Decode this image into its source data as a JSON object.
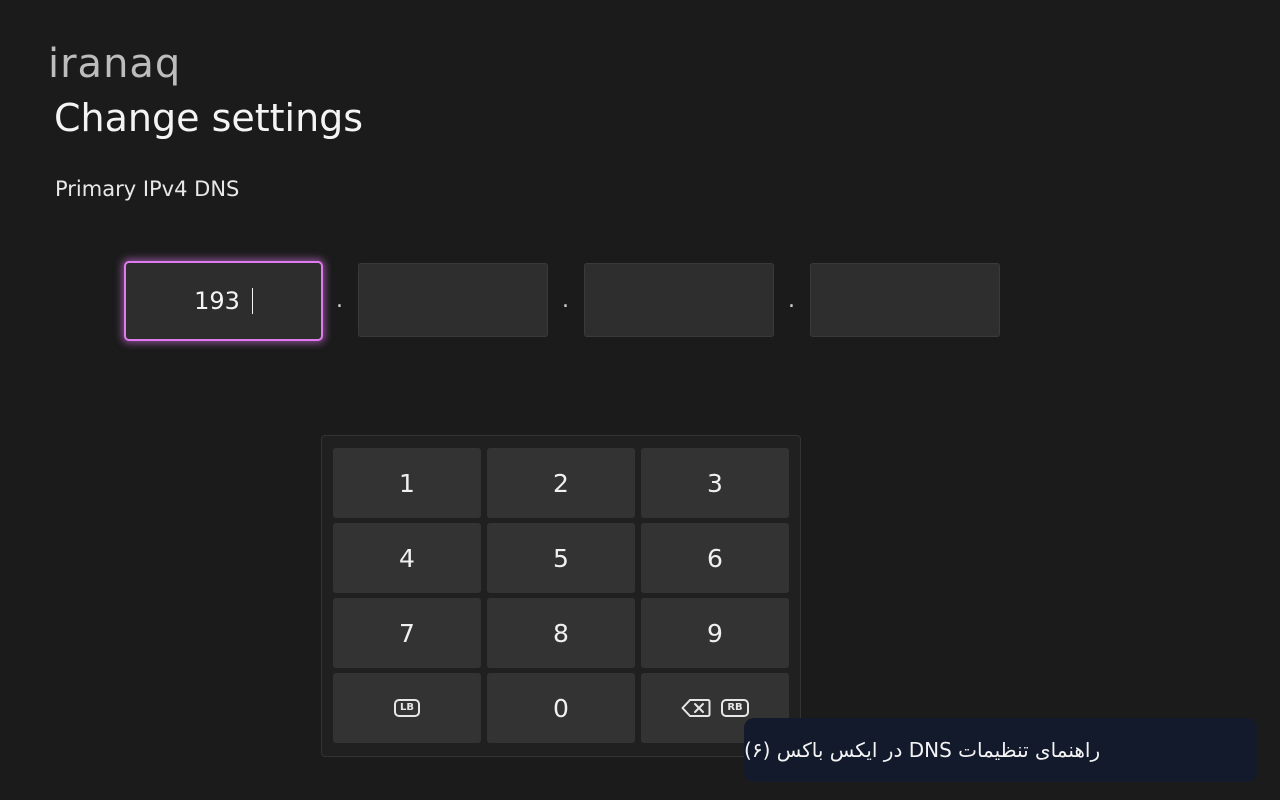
{
  "brand": {
    "logo_text": "iranaq"
  },
  "page": {
    "title": "Change settings",
    "field_label": "Primary IPv4 DNS"
  },
  "ip_input": {
    "octets": [
      "193",
      "",
      "",
      ""
    ],
    "separator": ".",
    "focused_index": 0
  },
  "keypad": {
    "keys": [
      "1",
      "2",
      "3",
      "4",
      "5",
      "6",
      "7",
      "8",
      "9",
      "LB",
      "0",
      "RB"
    ],
    "lb_label": "LB",
    "rb_label": "RB",
    "backspace_icon": "backspace-icon"
  },
  "caption": {
    "text": "راهنمای تنظیمات DNS در ایکس باکس (۶)"
  },
  "colors": {
    "background": "#1b1b1b",
    "focus_outline": "#e07af0",
    "key_bg": "#333333",
    "caption_bg": "#121a2c"
  }
}
